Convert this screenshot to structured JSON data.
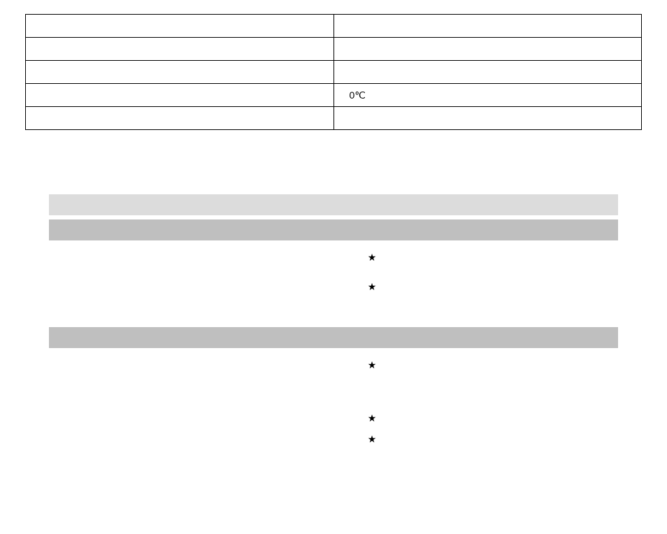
{
  "table": {
    "rows": [
      {
        "label": "",
        "value": ""
      },
      {
        "label": "",
        "value": ""
      },
      {
        "label": "",
        "value": ""
      },
      {
        "label": "",
        "value": "0℃"
      },
      {
        "label": "",
        "value": ""
      }
    ]
  },
  "section": {
    "heading_light": "",
    "group1": {
      "heading": "",
      "items": [
        {
          "left": "",
          "star": "★",
          "right": ""
        },
        {
          "left": "",
          "star": "★",
          "right": ""
        }
      ]
    },
    "group2": {
      "heading": "",
      "items": [
        {
          "left": "",
          "star": "★",
          "right": ""
        },
        {
          "left": "",
          "star": "★",
          "right": ""
        },
        {
          "left": "",
          "star": "★",
          "right": ""
        }
      ]
    }
  }
}
